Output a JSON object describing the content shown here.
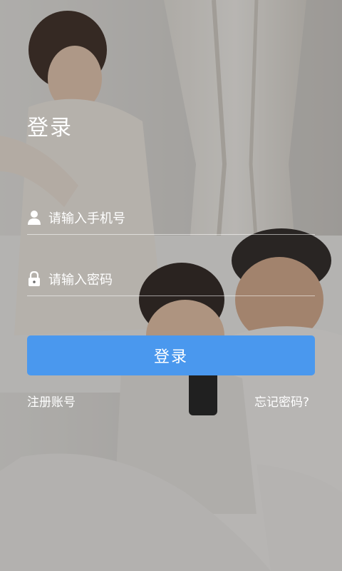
{
  "login_screen": {
    "title": "登录",
    "phone_field": {
      "placeholder": "请输入手机号",
      "value": "",
      "icon": "user-icon"
    },
    "password_field": {
      "placeholder": "请输入密码",
      "value": "",
      "icon": "lock-icon"
    },
    "login_button_label": "登录",
    "register_link": "注册账号",
    "forgot_link": "忘记密码?",
    "colors": {
      "button": "#4a98ee",
      "text": "#ffffff"
    },
    "background_image": "family-photo"
  }
}
